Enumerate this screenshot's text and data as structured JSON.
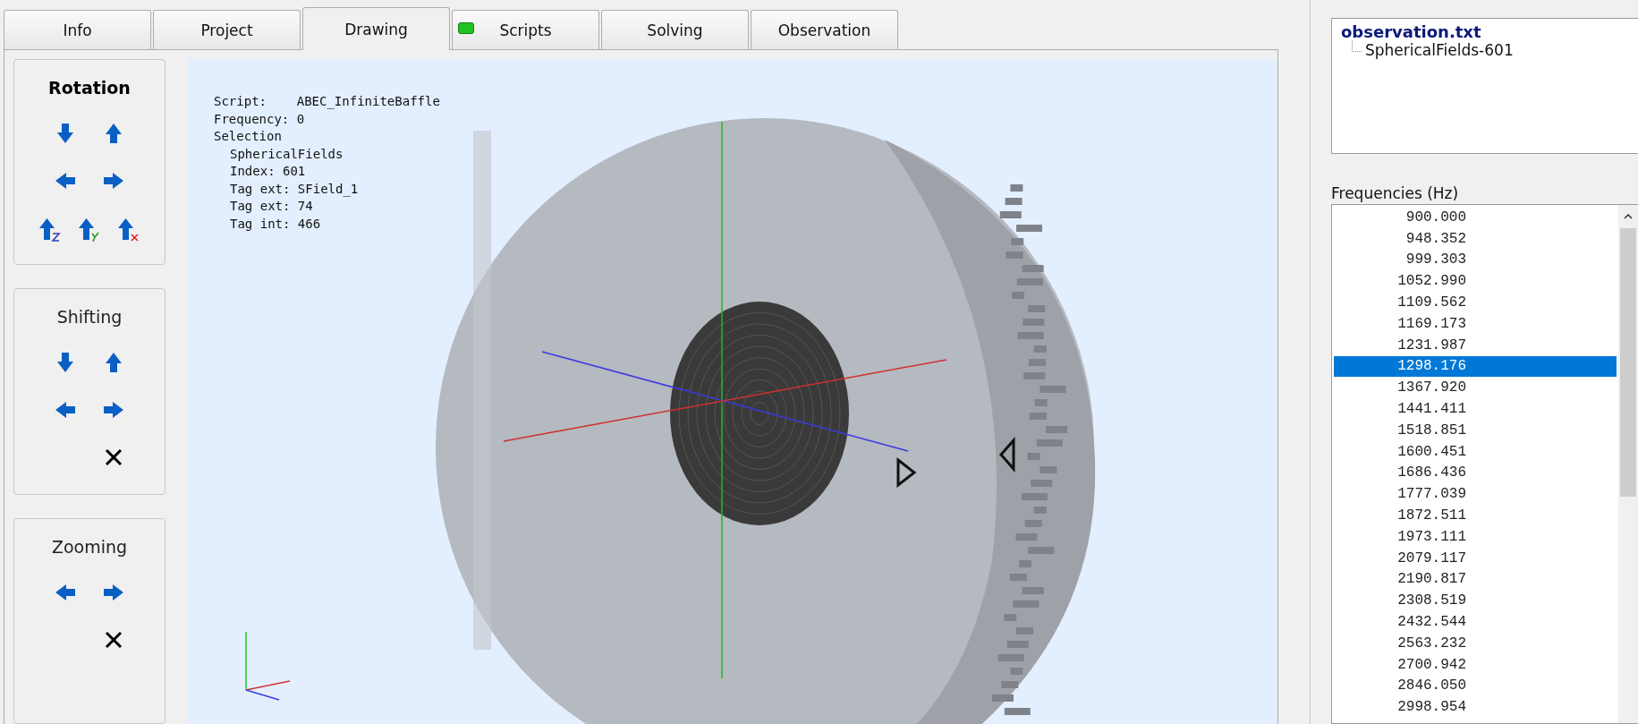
{
  "tabs": [
    {
      "label": "Info",
      "selected": false,
      "led": false
    },
    {
      "label": "Project",
      "selected": false,
      "led": false
    },
    {
      "label": "Drawing",
      "selected": true,
      "led": false
    },
    {
      "label": "Scripts",
      "selected": false,
      "led": true
    },
    {
      "label": "Solving",
      "selected": false,
      "led": false
    },
    {
      "label": "Observation",
      "selected": false,
      "led": false
    }
  ],
  "control_groups": [
    {
      "title": "Rotation",
      "emphasized": true,
      "rows": [
        [
          {
            "kind": "arrow-down"
          },
          {
            "kind": "arrow-up"
          }
        ],
        [
          {
            "kind": "arrow-left"
          },
          {
            "kind": "arrow-right"
          }
        ],
        [
          {
            "kind": "rotate-z"
          },
          {
            "kind": "rotate-y"
          },
          {
            "kind": "rotate-x"
          }
        ]
      ]
    },
    {
      "title": "Shifting",
      "emphasized": false,
      "rows": [
        [
          {
            "kind": "arrow-down"
          },
          {
            "kind": "arrow-up"
          }
        ],
        [
          {
            "kind": "arrow-left"
          },
          {
            "kind": "arrow-right"
          }
        ],
        [
          {
            "kind": "reset"
          }
        ]
      ]
    },
    {
      "title": "Zooming",
      "emphasized": false,
      "rows": [
        [
          {
            "kind": "arrow-left"
          },
          {
            "kind": "arrow-right"
          }
        ],
        [
          {
            "kind": "reset"
          }
        ]
      ]
    }
  ],
  "viewport": {
    "info_lines": [
      {
        "text": "Script:    ABEC_InfiniteBaffle"
      },
      {
        "text": "Frequency: 0"
      },
      {
        "text": "Selection",
        "children": [
          {
            "text": "SphericalFields"
          },
          {
            "text": "Index: 601"
          },
          {
            "text": "Tag ext: SField_1"
          },
          {
            "text": "Tag ext: 74"
          },
          {
            "text": "Tag int: 466"
          }
        ]
      }
    ]
  },
  "observation_tree": [
    {
      "label": "observation.txt",
      "children": [
        {
          "label": "SphericalFields-601"
        }
      ]
    }
  ],
  "frequencies": {
    "label": "Frequencies  (Hz)",
    "items": [
      {
        "value": "900.000",
        "selected": false
      },
      {
        "value": "948.352",
        "selected": false
      },
      {
        "value": "999.303",
        "selected": false
      },
      {
        "value": "1052.990",
        "selected": false
      },
      {
        "value": "1109.562",
        "selected": false
      },
      {
        "value": "1169.173",
        "selected": false
      },
      {
        "value": "1231.987",
        "selected": false
      },
      {
        "value": "1298.176",
        "selected": true
      },
      {
        "value": "1367.920",
        "selected": false
      },
      {
        "value": "1441.411",
        "selected": false
      },
      {
        "value": "1518.851",
        "selected": false
      },
      {
        "value": "1600.451",
        "selected": false
      },
      {
        "value": "1686.436",
        "selected": false
      },
      {
        "value": "1777.039",
        "selected": false
      },
      {
        "value": "1872.511",
        "selected": false
      },
      {
        "value": "1973.111",
        "selected": false
      },
      {
        "value": "2079.117",
        "selected": false
      },
      {
        "value": "2190.817",
        "selected": false
      },
      {
        "value": "2308.519",
        "selected": false
      },
      {
        "value": "2432.544",
        "selected": false
      },
      {
        "value": "2563.232",
        "selected": false
      },
      {
        "value": "2700.942",
        "selected": false
      },
      {
        "value": "2846.050",
        "selected": false
      },
      {
        "value": "2998.954",
        "selected": false
      }
    ]
  }
}
